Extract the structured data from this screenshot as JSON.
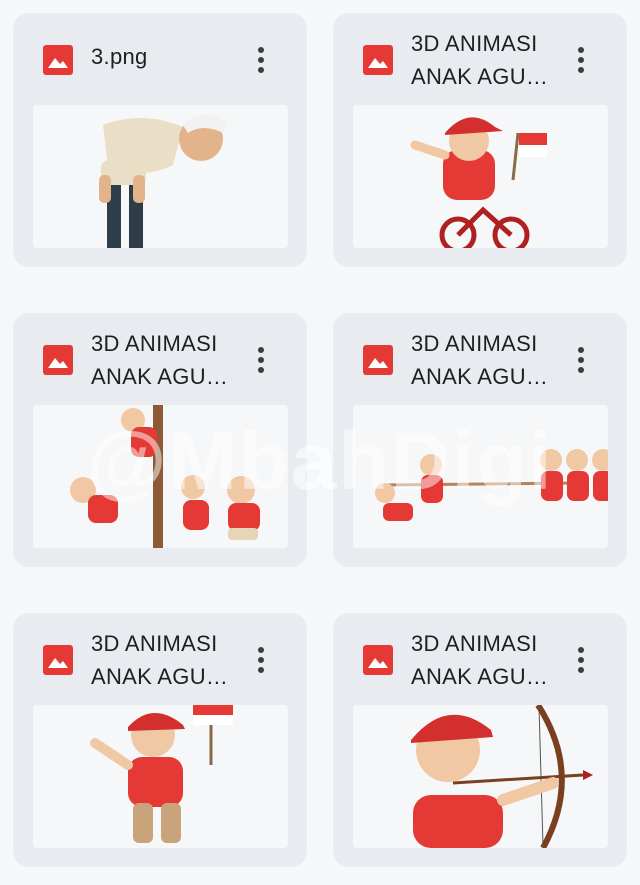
{
  "files": [
    {
      "name": "3.png",
      "icon": "image-file-icon"
    },
    {
      "name": "3D ANIMASI\nANAK AGU…",
      "icon": "image-file-icon"
    },
    {
      "name": "3D ANIMASI\nANAK AGU…",
      "icon": "image-file-icon"
    },
    {
      "name": "3D ANIMASI\nANAK AGU…",
      "icon": "image-file-icon"
    },
    {
      "name": "3D ANIMASI\nANAK AGU…",
      "icon": "image-file-icon"
    },
    {
      "name": "3D ANIMASI\nANAK AGU…",
      "icon": "image-file-icon"
    }
  ],
  "watermark": "@MbahDigi",
  "colors": {
    "accent_red": "#e53935",
    "card_bg": "#e8ecf0",
    "page_bg": "#f4f8fb"
  }
}
